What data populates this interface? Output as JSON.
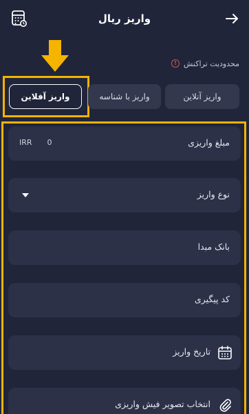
{
  "header": {
    "title": "واریز ریال",
    "back_icon": "arrow-right-icon",
    "calculator_icon": "calculator-icon"
  },
  "limits": {
    "label": "محدودیت تراکنش",
    "icon": "info-icon",
    "icon_color": "#e14b4b"
  },
  "tabs": [
    {
      "label": "واریز آنلاین",
      "active": false
    },
    {
      "label": "واریز با شناسه",
      "active": false
    },
    {
      "label": "واریز آفلاین",
      "active": true
    }
  ],
  "form": {
    "amount": {
      "label": "مبلغ واریزی",
      "value": "0",
      "currency": "IRR"
    },
    "deposit_type": {
      "label": "نوع واریز"
    },
    "source_bank": {
      "label": "بانک مبدا"
    },
    "tracking_code": {
      "label": "کد پیگیری"
    },
    "deposit_date": {
      "label": "تاریخ واریز",
      "icon": "calendar-icon"
    },
    "receipt_image": {
      "label": "انتخاب تصویر فیش واریزی",
      "icon": "paperclip-icon"
    }
  },
  "colors": {
    "background": "#21253a",
    "field": "#2c3148",
    "highlight": "#f4b400"
  }
}
